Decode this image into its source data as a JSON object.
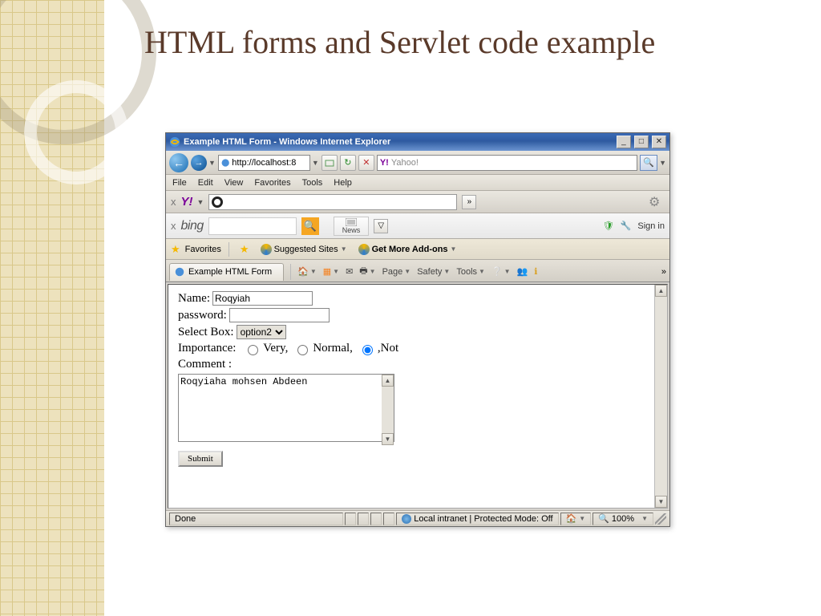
{
  "slide": {
    "title": "HTML forms and Servlet code example"
  },
  "titlebar": {
    "text": "Example HTML Form - Windows Internet Explorer"
  },
  "address": {
    "url": "http://localhost:8"
  },
  "search": {
    "provider_label": "Yahoo!"
  },
  "menus": {
    "file": "File",
    "edit": "Edit",
    "view": "View",
    "favorites": "Favorites",
    "tools": "Tools",
    "help": "Help"
  },
  "bing": {
    "news": "News",
    "signin": "Sign in"
  },
  "favbar": {
    "favorites": "Favorites",
    "suggested": "Suggested Sites",
    "addons": "Get More Add-ons"
  },
  "tab": {
    "title": "Example HTML Form",
    "page": "Page",
    "safety": "Safety",
    "tools": "Tools"
  },
  "form": {
    "name_label": "Name:",
    "name_value": "Roqyiah",
    "password_label": "password:",
    "password_value": "",
    "select_label": "Select Box:",
    "select_value": "option2",
    "importance_label": "Importance:",
    "radio_very": "Very,",
    "radio_normal": "Normal,",
    "radio_not": ",Not",
    "comment_label": "Comment :",
    "comment_value": "Roqyiaha mohsen Abdeen",
    "submit": "Submit"
  },
  "status": {
    "done": "Done",
    "zone": "Local intranet | Protected Mode: Off",
    "zoom": "100%"
  }
}
